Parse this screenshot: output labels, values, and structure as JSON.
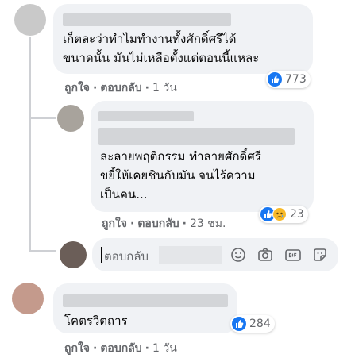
{
  "comments": [
    {
      "text_lines": [
        "เก็ตละว่าทำไมทำงานทั้งศักดิ์ศรีได้",
        "ขนาดนั้น มันไม่เหลือตั้งแต่ตอนนี้แหละ"
      ],
      "like_label": "ถูกใจ",
      "reply_label": "ตอบกลับ",
      "time": "1 วัน",
      "reaction_count": "773"
    },
    {
      "text_lines": [
        "ละลายพฤติกรรม ทำลายศักดิ์ศรี",
        "ขยี้ให้เคยชินกับมัน จนไร้ความ",
        "เป็นคน..."
      ],
      "like_label": "ถูกใจ",
      "reply_label": "ตอบกลับ",
      "time": "23 ชม.",
      "reaction_count": "23"
    },
    {
      "text_lines": [
        "โคตรวิตถาร"
      ],
      "like_label": "ถูกใจ",
      "reply_label": "ตอบกลับ",
      "time": "1 วัน",
      "reaction_count": "284"
    }
  ],
  "reply_box": {
    "placeholder": "ตอบกลับ",
    "tools": [
      "emoji-icon",
      "camera-icon",
      "gif-icon",
      "sticker-icon"
    ]
  },
  "colors": {
    "bubble": "#f0f2f5",
    "meta_text": "#65676b",
    "like_blue": "#1877f2",
    "sad_yellow": "#f7b928"
  }
}
